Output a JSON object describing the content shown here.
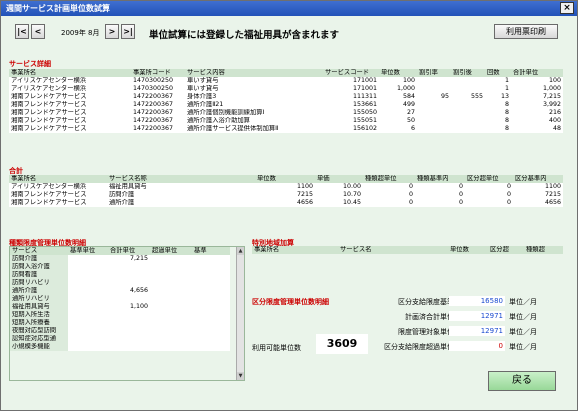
{
  "window": {
    "title": "週間サービス計画単位数試算",
    "close_label": "×"
  },
  "toolbar": {
    "first_label": "|<",
    "prev_label": "<",
    "month_label": "2009年 8月",
    "next_label": ">",
    "last_label": ">|",
    "notice": "単位試算には登録した福祉用具が含まれます",
    "print_label": "利用票印刷"
  },
  "service_detail": {
    "title": "サービス詳細",
    "columns": [
      "事業所名",
      "事業所コード",
      "サービス内容",
      "サービスコード",
      "単位数",
      "割引率",
      "割引後",
      "回数",
      "合計単位"
    ],
    "rows": [
      [
        "アイリスケアセンター横浜",
        "1470300250",
        "車いす貸与",
        "171001",
        "100",
        "",
        "",
        "1",
        "100"
      ],
      [
        "アイリスケアセンター横浜",
        "1470300250",
        "車いす貸与",
        "171001",
        "1,000",
        "",
        "",
        "1",
        "1,000"
      ],
      [
        "湘南フレンドケアサービス",
        "1472200367",
        "身体介護3",
        "111311",
        "584",
        "95",
        "555",
        "13",
        "7,215"
      ],
      [
        "湘南フレンドケアサービス",
        "1472200367",
        "通所介護Ⅱ21",
        "153661",
        "499",
        "",
        "",
        "8",
        "3,992"
      ],
      [
        "湘南フレンドケアサービス",
        "1472200367",
        "通所介護個別機能訓練加算Ⅰ",
        "155050",
        "27",
        "",
        "",
        "8",
        "216"
      ],
      [
        "湘南フレンドケアサービス",
        "1472200367",
        "通所介護入浴介助加算",
        "155051",
        "50",
        "",
        "",
        "8",
        "400"
      ],
      [
        "湘南フレンドケアサービス",
        "1472200367",
        "通所介護サービス提供体制加算Ⅱ",
        "156102",
        "6",
        "",
        "",
        "8",
        "48"
      ]
    ]
  },
  "total": {
    "title": "合計",
    "columns": [
      "事業所名",
      "サービス名称",
      "単位数",
      "単価",
      "種類超単位",
      "種類基準内",
      "区分超単位",
      "区分基準内"
    ],
    "rows": [
      [
        "アイリスケアセンター横浜",
        "福祉用具貸与",
        "1100",
        "10.00",
        "0",
        "0",
        "0",
        "1100"
      ],
      [
        "湘南フレンドケアサービス",
        "訪問介護",
        "7215",
        "10.70",
        "0",
        "0",
        "0",
        "7215"
      ],
      [
        "湘南フレンドケアサービス",
        "通所介護",
        "4656",
        "10.45",
        "0",
        "0",
        "0",
        "4656"
      ]
    ]
  },
  "type_limit": {
    "title": "種類限度管理単位数明細",
    "columns": [
      "サービス",
      "基準単位",
      "合計単位",
      "超過単位",
      "基準"
    ],
    "rows": [
      [
        "訪問介護",
        "",
        "7,215",
        "",
        ""
      ],
      [
        "訪問入浴介護",
        "",
        "",
        "",
        ""
      ],
      [
        "訪問看護",
        "",
        "",
        "",
        ""
      ],
      [
        "訪問リハビリ",
        "",
        "",
        "",
        ""
      ],
      [
        "通所介護",
        "",
        "4,656",
        "",
        ""
      ],
      [
        "通所リハビリ",
        "",
        "",
        "",
        ""
      ],
      [
        "福祉用具貸与",
        "",
        "1,100",
        "",
        ""
      ],
      [
        "短期入所生活",
        "",
        "",
        "",
        ""
      ],
      [
        "短期入所療養",
        "",
        "",
        "",
        ""
      ],
      [
        "夜間対応型訪問",
        "",
        "",
        "",
        ""
      ],
      [
        "認知症対応型通",
        "",
        "",
        "",
        ""
      ],
      [
        "小規模多機能",
        "",
        "",
        "",
        ""
      ]
    ]
  },
  "special_area": {
    "title": "特別地域加算",
    "columns": [
      "事業所名",
      "サービス名",
      "単位数",
      "区分超",
      "種類超"
    ]
  },
  "category_limit": {
    "title": "区分限度管理単位数明細",
    "items": [
      {
        "label": "区分支給限度基準額",
        "value": "16580",
        "unit": "単位／月",
        "color": "#1a4ad0"
      },
      {
        "label": "計画済合計単位数",
        "value": "12971",
        "unit": "単位／月",
        "color": "#1a4ad0"
      },
      {
        "label": "限度管理対象単位数",
        "value": "12971",
        "unit": "単位／月",
        "color": "#1a4ad0"
      },
      {
        "label": "区分支給限度超過単位数",
        "value": "0",
        "unit": "単位／月",
        "color": "#cc0000"
      }
    ],
    "available_label": "利用可能単位数",
    "available_value": "3609"
  },
  "footer": {
    "back_label": "戻る"
  }
}
